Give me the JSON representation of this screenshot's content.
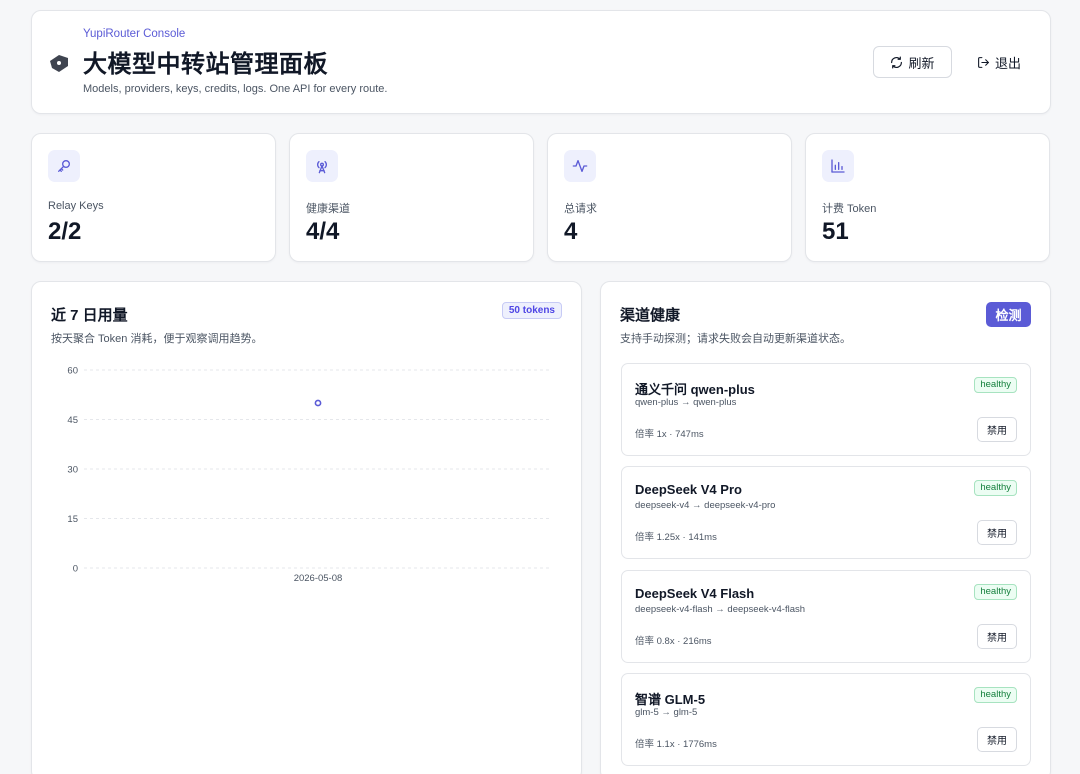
{
  "header": {
    "eyebrow": "YupiRouter Console",
    "title": "大模型中转站管理面板",
    "subtitle": "Models, providers, keys, credits, logs. One API for every route.",
    "refresh_label": "刷新",
    "logout_label": "退出",
    "brand_icon": "tag-icon"
  },
  "stats": [
    {
      "icon": "key-icon",
      "label": "Relay Keys",
      "value": "2/2"
    },
    {
      "icon": "antenna-icon",
      "label": "健康渠道",
      "value": "4/4"
    },
    {
      "icon": "activity-icon",
      "label": "总请求",
      "value": "4"
    },
    {
      "icon": "bar-chart-icon",
      "label": "计费 Token",
      "value": "51"
    }
  ],
  "usage": {
    "title": "近 7 日用量",
    "description": "按天聚合 Token 消耗，便于观察调用趋势。",
    "badge": "50 tokens"
  },
  "chart_data": {
    "type": "scatter",
    "x": [
      "2026-05-08"
    ],
    "series": [
      {
        "values": [
          50
        ]
      }
    ],
    "yticks": [
      0,
      15,
      30,
      45,
      60
    ],
    "ylim": [
      0,
      60
    ],
    "grid": true,
    "grid_style": "dashed",
    "accent": "#5b5bd6"
  },
  "health": {
    "title": "渠道健康",
    "description": "支持手动探测；请求失败会自动更新渠道状态。",
    "detect_label": "检测",
    "channels": [
      {
        "name": "通义千问 qwen-plus",
        "route": "qwen-plus → qwen-plus",
        "meta": "倍率 1x · 747ms",
        "status": "healthy",
        "action": "禁用"
      },
      {
        "name": "DeepSeek V4 Pro",
        "route": "deepseek-v4 → deepseek-v4-pro",
        "meta": "倍率 1.25x · 141ms",
        "status": "healthy",
        "action": "禁用"
      },
      {
        "name": "DeepSeek V4 Flash",
        "route": "deepseek-v4-flash → deepseek-v4-flash",
        "meta": "倍率 0.8x · 216ms",
        "status": "healthy",
        "action": "禁用"
      },
      {
        "name": "智谱 GLM-5",
        "route": "glm-5 → glm-5",
        "meta": "倍率 1.1x · 1776ms",
        "status": "healthy",
        "action": "禁用"
      }
    ]
  },
  "colors": {
    "accent": "#5b5bd6",
    "healthy": "#15803d",
    "icon_bg": "#eef0fd"
  }
}
